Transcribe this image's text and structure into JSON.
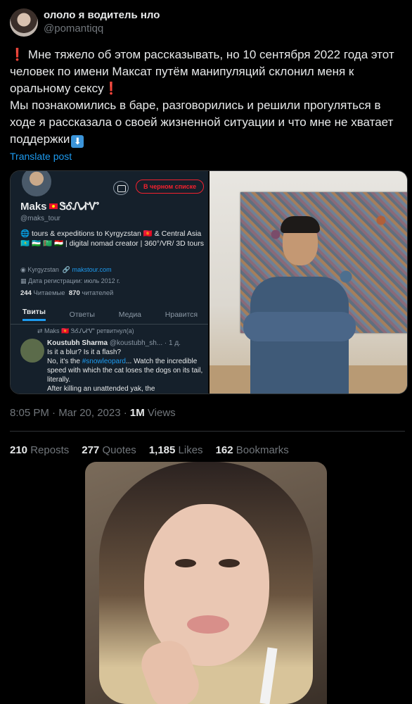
{
  "author": {
    "display_name": "ололо я водитель нло",
    "handle": "@pomantiqq"
  },
  "post": {
    "line1": "Мне тяжело об этом рассказывать, но 10 сентября 2022 года этот человек по имени Максат путём манипуляций склонил меня к оральному сексу",
    "line2": "Мы познакомились в баре, разговорились и решили прогуляться в ходе я рассказала о своей жизненной ситуации и что мне не хватает поддержки",
    "exclamation": "❗",
    "down_arrow": "⬇",
    "translate_label": "Translate post"
  },
  "embedded_profile": {
    "blocked_label": "В черном списке",
    "name": "Maks",
    "name_extra": "ᏕᎴᏁᏗᏉ",
    "handle": "@maks_tour",
    "bio": "🌐 tours & expeditions to Kyrgyzstan 🇰🇬 & Central Asia 🇰🇿 🇺🇿 🇹🇲 🇹🇯 | digital nomad creator | 360°/VR/ 3D tours",
    "location": "Kyrgyzstan",
    "website": "makstour.com",
    "joined": "Дата регистрации: июль 2012 г.",
    "following_count": "244",
    "following_label": "Читаемые",
    "followers_count": "870",
    "followers_label": "читателей",
    "tabs": [
      "Твиты",
      "Ответы",
      "Медиа",
      "Нравится"
    ],
    "retweet_line": "Maks 🇰🇬 ᏕᎴᏁᏗᏉ ретвитнул(а)",
    "tweet_author": "Koustubh Sharma",
    "tweet_handle": "@koustubh_sh... · 1 д.",
    "tweet_lines": [
      "Is it a blur? Is it a flash?",
      "No, it's the ",
      "... Watch the incredible speed with which the cat loses the dogs on its tail, literally.",
      "After killing an unattended yak, the"
    ],
    "tweet_hashtag": "#snowleopard"
  },
  "timestamp": "8:05 PM · Mar 20, 2023 · ",
  "views_count": "1M",
  "views_label": " Views",
  "stats": {
    "reposts_count": "210",
    "reposts_label": "Reposts",
    "quotes_count": "277",
    "quotes_label": "Quotes",
    "likes_count": "1,185",
    "likes_label": "Likes",
    "bookmarks_count": "162",
    "bookmarks_label": "Bookmarks"
  },
  "colors": {
    "accent": "#1d9bf0",
    "danger": "#f4212e",
    "background": "#000000",
    "muted": "#71767b"
  }
}
